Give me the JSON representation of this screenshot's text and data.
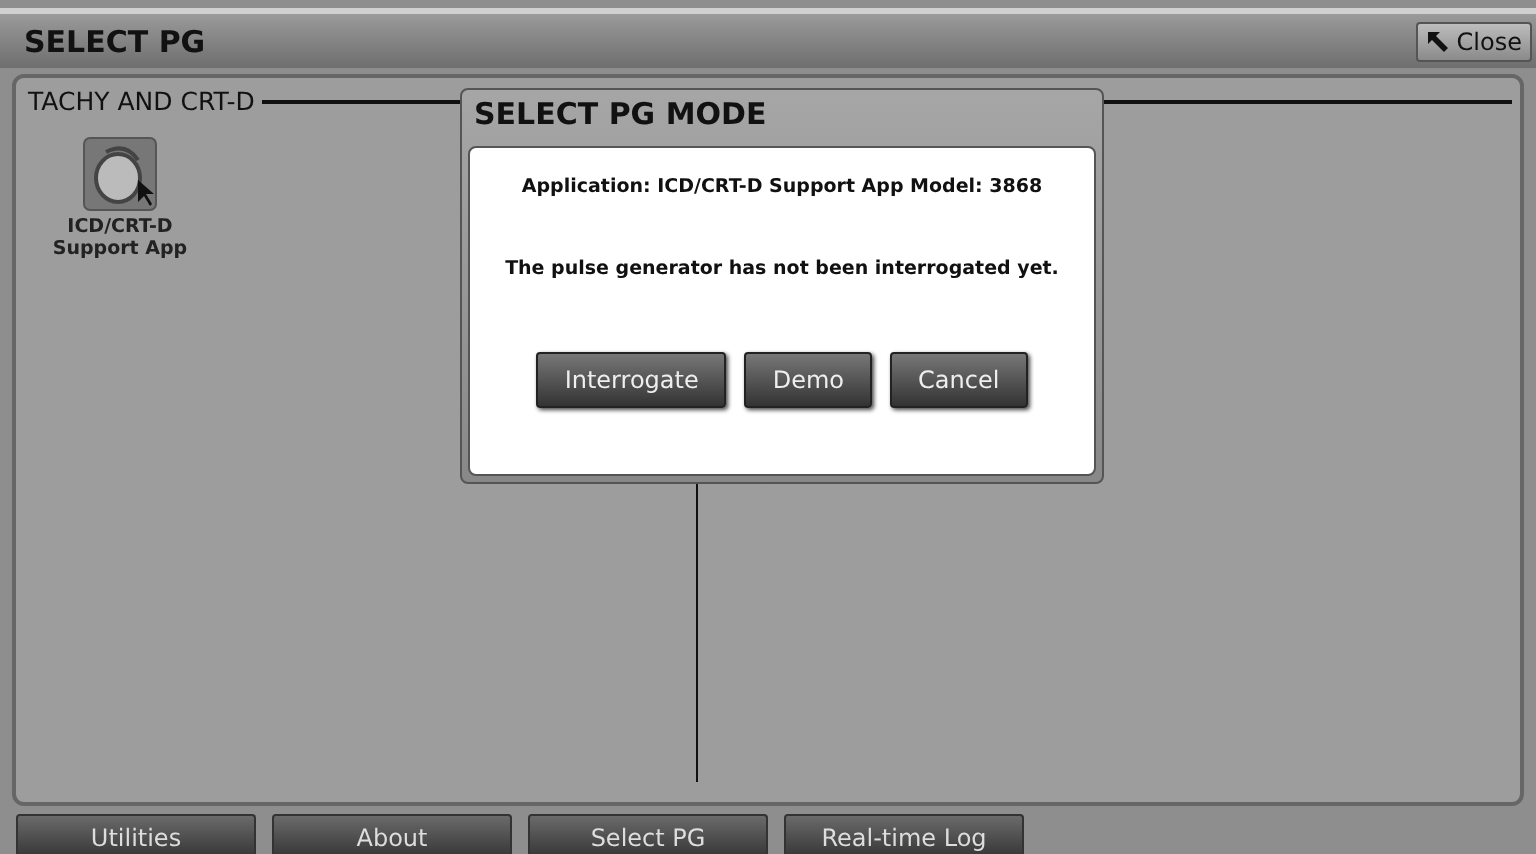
{
  "window": {
    "title": "SELECT PG",
    "close_button": "Close"
  },
  "group": {
    "title": "TACHY AND CRT-D",
    "apps": [
      {
        "label": "ICD/CRT-D Support App"
      }
    ]
  },
  "dialog": {
    "title": "SELECT PG MODE",
    "lines": [
      "Application: ICD/CRT-D Support App Model: 3868",
      "The pulse generator has not been interrogated yet."
    ],
    "buttons": [
      "Interrogate",
      "Demo",
      "Cancel"
    ]
  },
  "nav_tabs": [
    "Utilities",
    "About",
    "Select PG",
    "Real-time Log"
  ]
}
